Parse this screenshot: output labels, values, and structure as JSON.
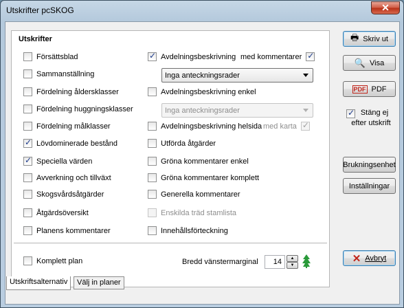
{
  "window": {
    "title": "Utskrifter pcSKOG",
    "close_label": "✕"
  },
  "group": {
    "title": "Utskrifter"
  },
  "left_options": [
    {
      "label": "Försättsblad",
      "checked": false
    },
    {
      "label": "Sammanställning",
      "checked": false
    },
    {
      "label": "Fördelning åldersklasser",
      "checked": false
    },
    {
      "label": "Fördelning huggningsklasser",
      "checked": false
    },
    {
      "label": "Fördelning målklasser",
      "checked": false
    },
    {
      "label": "Lövdominerade bestånd",
      "checked": true
    },
    {
      "label": "Speciella värden",
      "checked": true
    },
    {
      "label": "Avverkning och tillväxt",
      "checked": false
    },
    {
      "label": "Skogsvårdsåtgärder",
      "checked": false
    },
    {
      "label": "Åtgärdsöversikt",
      "checked": false
    },
    {
      "label": "Planens kommentarer",
      "checked": false
    }
  ],
  "right_options": {
    "avd_beskrivning": {
      "label": "Avdelningsbeskrivning",
      "checked": true
    },
    "med_kommentarer": {
      "label": "med kommentarer",
      "checked": true
    },
    "dropdown1": {
      "value": "Inga anteckningsrader"
    },
    "avd_enkel": {
      "label": "Avdelningsbeskrivning enkel",
      "checked": false
    },
    "dropdown2": {
      "value": "Inga anteckningsrader"
    },
    "avd_helsida": {
      "label": "Avdelningsbeskrivning helsida",
      "checked": false
    },
    "med_karta": {
      "label": "med karta",
      "checked": true
    },
    "utforda": {
      "label": "Utförda åtgärder",
      "checked": false
    },
    "grona_enkel": {
      "label": "Gröna kommentarer enkel",
      "checked": false
    },
    "grona_komplett": {
      "label": "Gröna kommentarer komplett",
      "checked": false
    },
    "generella": {
      "label": "Generella kommentarer",
      "checked": false
    },
    "enskilda": {
      "label": "Enskilda träd stamlista",
      "checked": false
    },
    "innehall": {
      "label": "Innehållsförteckning",
      "checked": false
    }
  },
  "bottom": {
    "komplett": {
      "label": "Komplett plan",
      "checked": false
    },
    "margin_label": "Bredd vänstermarginal",
    "margin_value": "14"
  },
  "buttons": {
    "print": "Skriv ut",
    "view": "Visa",
    "pdf": "PDF",
    "keep_open": "Stäng ej efter utskrift",
    "brukning": "Brukningsenhet",
    "settings": "Inställningar",
    "cancel": "Avbryt"
  },
  "tabs": [
    "Utskriftsalternativ",
    "Välj in planer"
  ]
}
